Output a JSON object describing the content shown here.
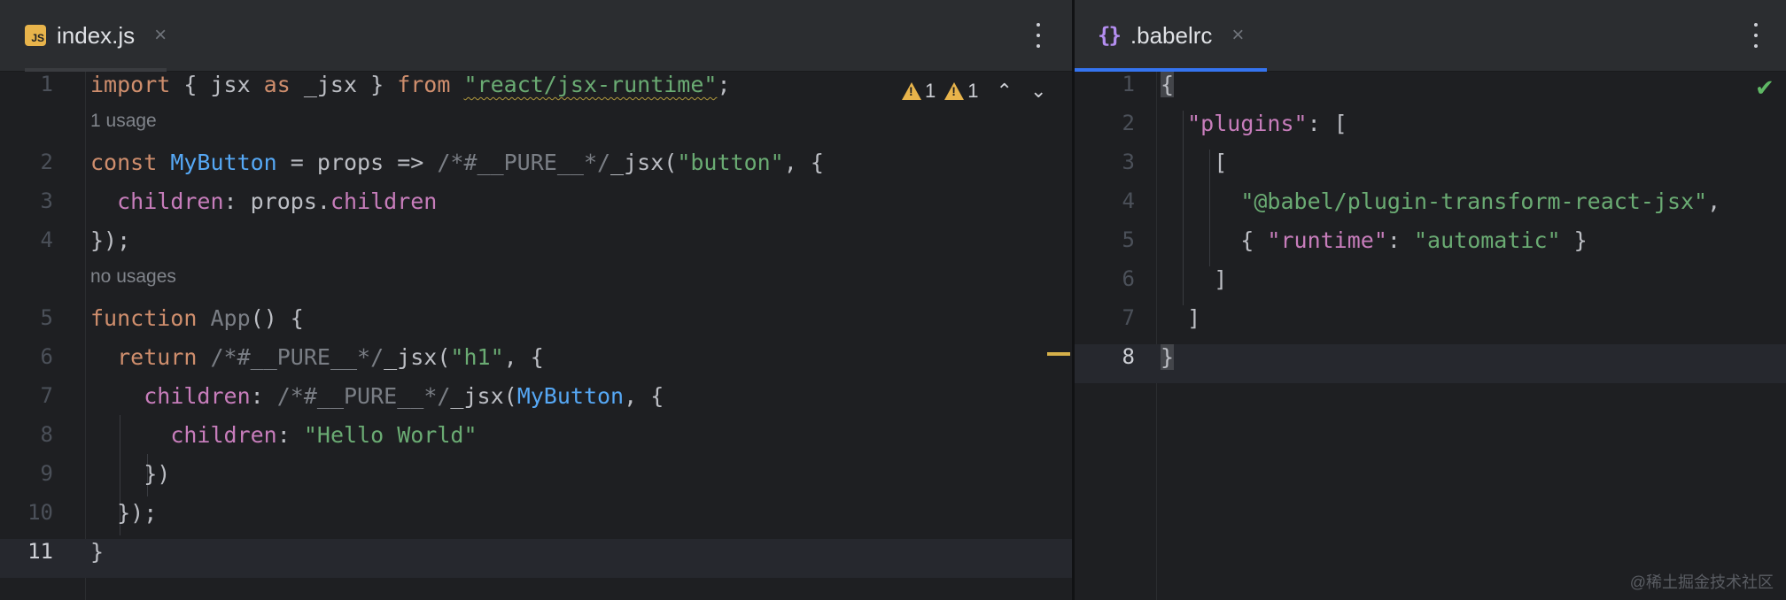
{
  "left_tab": {
    "icon": "javascript-file-icon",
    "badge": "JS",
    "title": "index.js",
    "close": "×"
  },
  "right_tab": {
    "icon": "json-braces-icon",
    "icon_glyph": "{}",
    "title": ".babelrc",
    "close": "×"
  },
  "inspections": {
    "warning_count_1": "1",
    "warning_count_2": "1",
    "up_arrow": "⌃",
    "down_arrow": "⌄"
  },
  "left_code": {
    "line_numbers": [
      "1",
      "2",
      "3",
      "4",
      "5",
      "6",
      "7",
      "8",
      "9",
      "10",
      "11"
    ],
    "hints": {
      "h1": "1 usage",
      "h2": "no usages"
    },
    "l1": {
      "kw_import": "import",
      "t1": " { jsx ",
      "kw_as": "as",
      "t2": " _jsx } ",
      "kw_from": "from",
      "t3": " ",
      "s_module": "\"react/jsx-runtime\"",
      "t4": ";"
    },
    "l2": {
      "kw_const": "const",
      "t1": " ",
      "fn_mybutton": "MyButton",
      "t2": " = props => ",
      "c_pure": "/*#__PURE__*/",
      "t3": "_jsx(",
      "s_button": "\"button\"",
      "t4": ", {"
    },
    "l3": {
      "t1": "  ",
      "p_children": "children",
      "t2": ": props.",
      "p_children2": "children"
    },
    "l4": {
      "t1": "});"
    },
    "l5": {
      "kw_function": "function",
      "t1": " ",
      "fn_app": "App",
      "t2": "() {"
    },
    "l6": {
      "t1": "  ",
      "kw_return": "return",
      "t2": " ",
      "c_pure": "/*#__PURE__*/",
      "t3": "_jsx(",
      "s_h1": "\"h1\"",
      "t4": ", {"
    },
    "l7": {
      "t1": "    ",
      "p_children": "children",
      "t2": ": ",
      "c_pure": "/*#__PURE__*/",
      "t3": "_jsx(",
      "fn_mybutton": "MyButton",
      "t4": ", {"
    },
    "l8": {
      "t1": "      ",
      "p_children": "children",
      "t2": ": ",
      "s_hello": "\"Hello World\""
    },
    "l9": {
      "t1": "    })"
    },
    "l10": {
      "t1": "  });"
    },
    "l11": {
      "t1": "}"
    }
  },
  "right_code": {
    "line_numbers": [
      "1",
      "2",
      "3",
      "4",
      "5",
      "6",
      "7",
      "8"
    ],
    "l1": {
      "t1": "{"
    },
    "l2": {
      "t1": "  ",
      "p_plugins": "\"plugins\"",
      "t2": ": ["
    },
    "l3": {
      "t1": "    ["
    },
    "l4": {
      "t1": "      ",
      "s_plugin": "\"@babel/plugin-transform-react-jsx\"",
      "t2": ","
    },
    "l5": {
      "t1": "      { ",
      "p_runtime": "\"runtime\"",
      "t2": ": ",
      "s_automatic": "\"automatic\"",
      "t3": " }"
    },
    "l6": {
      "t1": "    ]"
    },
    "l7": {
      "t1": "  ]"
    },
    "l8": {
      "t1": "}"
    }
  },
  "watermark": "@稀土掘金技术社区",
  "colors": {
    "keyword": "#cf8e6d",
    "function": "#56a8f5",
    "string": "#6aab73",
    "property": "#c77dbb",
    "comment": "#7a7e85",
    "text": "#bcbec4",
    "tab_underline": "#3574f0",
    "warning": "#e8b44b",
    "check": "#5fb865"
  }
}
